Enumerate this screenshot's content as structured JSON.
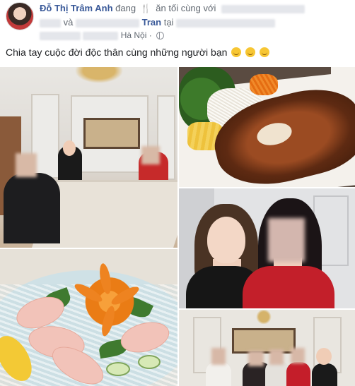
{
  "post": {
    "author": "Đỗ Thị Trâm Anh",
    "activity_prefix": "đang",
    "activity": "ăn tối cùng với",
    "and_word": "và",
    "tagged_suffix": "Tran",
    "at_word": "tại",
    "location": "Hà Nội",
    "caption": "Chia tay cuộc đời độc thân cùng những người bạn"
  },
  "icons": {
    "activity": "fork-knife-icon",
    "privacy": "globe-icon",
    "emoji": "smiling-face-icon"
  },
  "colors": {
    "author_link": "#385898",
    "muted_text": "#606770",
    "body_text": "#1c1e21"
  }
}
